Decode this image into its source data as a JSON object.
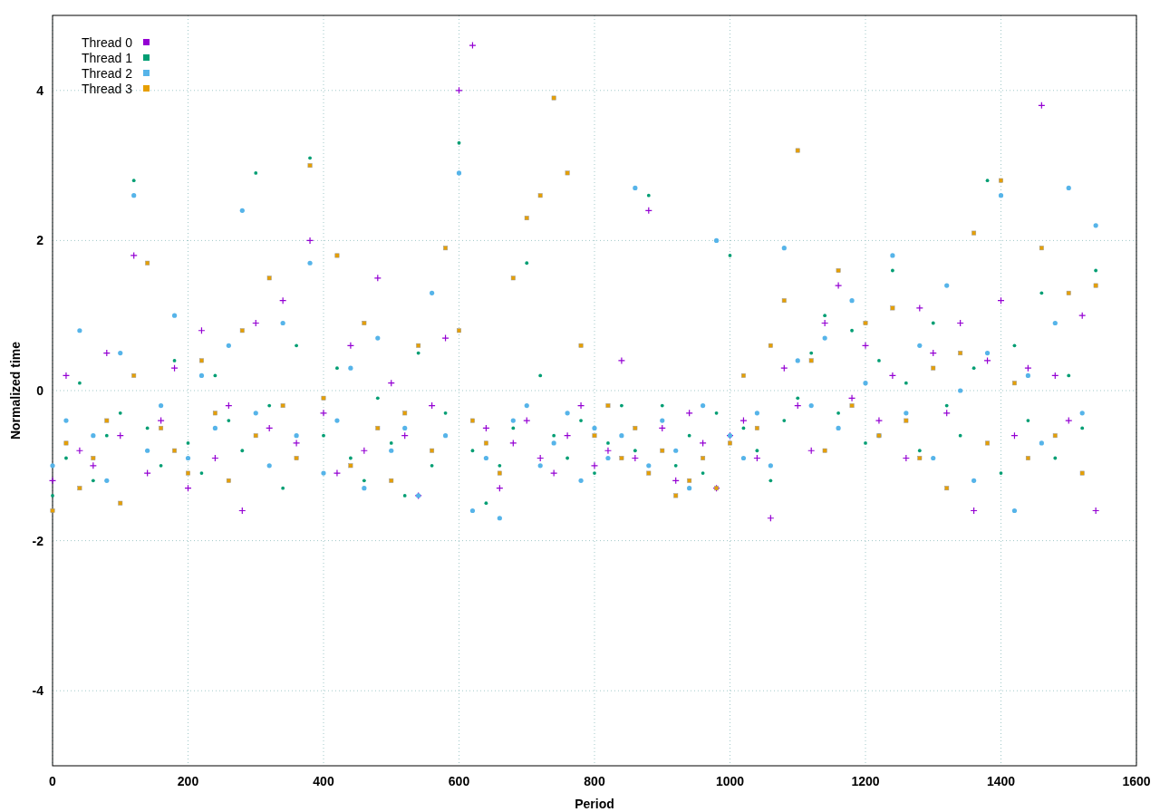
{
  "chart_data": {
    "type": "scatter",
    "grid": true,
    "xlabel": "Period",
    "ylabel": "Normalized time",
    "xlim": [
      0,
      1600
    ],
    "ylim": [
      -5,
      5
    ],
    "xticks": [
      0,
      200,
      400,
      600,
      800,
      1000,
      1200,
      1400,
      1600
    ],
    "yticks": [
      -4,
      -2,
      0,
      2,
      4
    ],
    "x": [
      0,
      20,
      40,
      60,
      80,
      100,
      120,
      140,
      160,
      180,
      200,
      220,
      240,
      260,
      280,
      300,
      320,
      340,
      360,
      380,
      400,
      420,
      440,
      460,
      480,
      500,
      520,
      540,
      560,
      580,
      600,
      620,
      640,
      660,
      680,
      700,
      720,
      740,
      760,
      780,
      800,
      820,
      840,
      860,
      880,
      900,
      920,
      940,
      960,
      980,
      1000,
      1020,
      1040,
      1060,
      1080,
      1100,
      1120,
      1140,
      1160,
      1180,
      1200,
      1220,
      1240,
      1260,
      1280,
      1300,
      1320,
      1340,
      1360,
      1380,
      1400,
      1420,
      1440,
      1460,
      1480,
      1500,
      1520,
      1540
    ],
    "series": [
      {
        "name": "Thread 0",
        "color": "#9400d3",
        "values": [
          -1.2,
          0.2,
          -0.8,
          -1.0,
          0.5,
          -0.6,
          1.8,
          -1.1,
          -0.4,
          0.3,
          -1.3,
          0.8,
          -0.9,
          -0.2,
          -1.6,
          0.9,
          -0.5,
          1.2,
          -0.7,
          2.0,
          -0.3,
          -1.1,
          0.6,
          -0.8,
          1.5,
          0.1,
          -0.6,
          -1.4,
          -0.2,
          0.7,
          4.0,
          4.6,
          -0.5,
          -1.3,
          -0.7,
          -0.4,
          -0.9,
          -1.1,
          -0.6,
          -0.2,
          -1.0,
          -0.8,
          0.4,
          -0.9,
          2.4,
          -0.5,
          -1.2,
          -0.3,
          -0.7,
          -1.3,
          -0.6,
          -0.4,
          -0.9,
          -1.7,
          0.3,
          -0.2,
          -0.8,
          0.9,
          1.4,
          -0.1,
          0.6,
          -0.4,
          0.2,
          -0.9,
          1.1,
          0.5,
          -0.3,
          0.9,
          -1.6,
          0.4,
          1.2,
          -0.6,
          0.3,
          3.8,
          0.2,
          -0.4,
          1.0,
          -1.6
        ]
      },
      {
        "name": "Thread 1",
        "color": "#009e73",
        "values": [
          -1.4,
          -0.9,
          0.1,
          -1.2,
          -0.6,
          -0.3,
          2.8,
          -0.5,
          -1.0,
          0.4,
          -0.7,
          -1.1,
          0.2,
          -0.4,
          -0.8,
          2.9,
          -0.2,
          -1.3,
          0.6,
          3.1,
          -0.6,
          0.3,
          -0.9,
          -1.2,
          -0.1,
          -0.7,
          -1.4,
          0.5,
          -1.0,
          -0.3,
          3.3,
          -0.8,
          -1.5,
          -1.0,
          -0.5,
          1.7,
          0.2,
          -0.6,
          -0.9,
          -0.4,
          -1.1,
          -0.7,
          -0.2,
          -0.8,
          2.6,
          -0.2,
          -1.0,
          -0.6,
          -1.1,
          -0.3,
          1.8,
          -0.5,
          -0.8,
          -1.2,
          -0.4,
          -0.1,
          0.5,
          1.0,
          -0.3,
          0.8,
          -0.7,
          0.4,
          1.6,
          0.1,
          -0.8,
          0.9,
          -0.2,
          -0.6,
          0.3,
          2.8,
          -1.1,
          0.6,
          -0.4,
          1.3,
          -0.9,
          0.2,
          -0.5,
          1.6
        ]
      },
      {
        "name": "Thread 2",
        "color": "#56b4e9",
        "values": [
          -1.0,
          -0.4,
          0.8,
          -0.6,
          -1.2,
          0.5,
          2.6,
          -0.8,
          -0.2,
          1.0,
          -0.9,
          0.2,
          -0.5,
          0.6,
          2.4,
          -0.3,
          -1.0,
          0.9,
          -0.6,
          1.7,
          -1.1,
          -0.4,
          0.3,
          -1.3,
          0.7,
          -0.8,
          -0.5,
          -1.4,
          1.3,
          -0.6,
          2.9,
          -1.6,
          -0.9,
          -1.7,
          -0.4,
          -0.2,
          -1.0,
          -0.7,
          -0.3,
          -1.2,
          -0.5,
          -0.9,
          -0.6,
          2.7,
          -1.0,
          -0.4,
          -0.8,
          -1.3,
          -0.2,
          2.0,
          -0.6,
          -0.9,
          -0.3,
          -1.0,
          1.9,
          0.4,
          -0.2,
          0.7,
          -0.5,
          1.2,
          0.1,
          -0.6,
          1.8,
          -0.3,
          0.6,
          -0.9,
          1.4,
          0.0,
          -1.2,
          0.5,
          2.6,
          -1.6,
          0.2,
          -0.7,
          0.9,
          2.7,
          -0.3,
          2.2
        ]
      },
      {
        "name": "Thread 3",
        "color": "#e69f00",
        "values": [
          -1.6,
          -0.7,
          -1.3,
          -0.9,
          -0.4,
          -1.5,
          0.2,
          1.7,
          -0.5,
          -0.8,
          -1.1,
          0.4,
          -0.3,
          -1.2,
          0.8,
          -0.6,
          1.5,
          -0.2,
          -0.9,
          3.0,
          -0.1,
          1.8,
          -1.0,
          0.9,
          -0.5,
          -1.2,
          -0.3,
          0.6,
          -0.8,
          1.9,
          0.8,
          -0.4,
          -0.7,
          -1.1,
          1.5,
          2.3,
          2.6,
          3.9,
          2.9,
          0.6,
          -0.6,
          -0.2,
          -0.9,
          -0.5,
          -1.1,
          -0.8,
          -1.4,
          -1.2,
          -0.9,
          -1.3,
          -0.7,
          0.2,
          -0.5,
          0.6,
          1.2,
          3.2,
          0.4,
          -0.8,
          1.6,
          -0.2,
          0.9,
          -0.6,
          1.1,
          -0.4,
          -0.9,
          0.3,
          -1.3,
          0.5,
          2.1,
          -0.7,
          2.8,
          0.1,
          -0.9,
          1.9,
          -0.6,
          1.3,
          -1.1,
          1.4
        ]
      }
    ]
  }
}
